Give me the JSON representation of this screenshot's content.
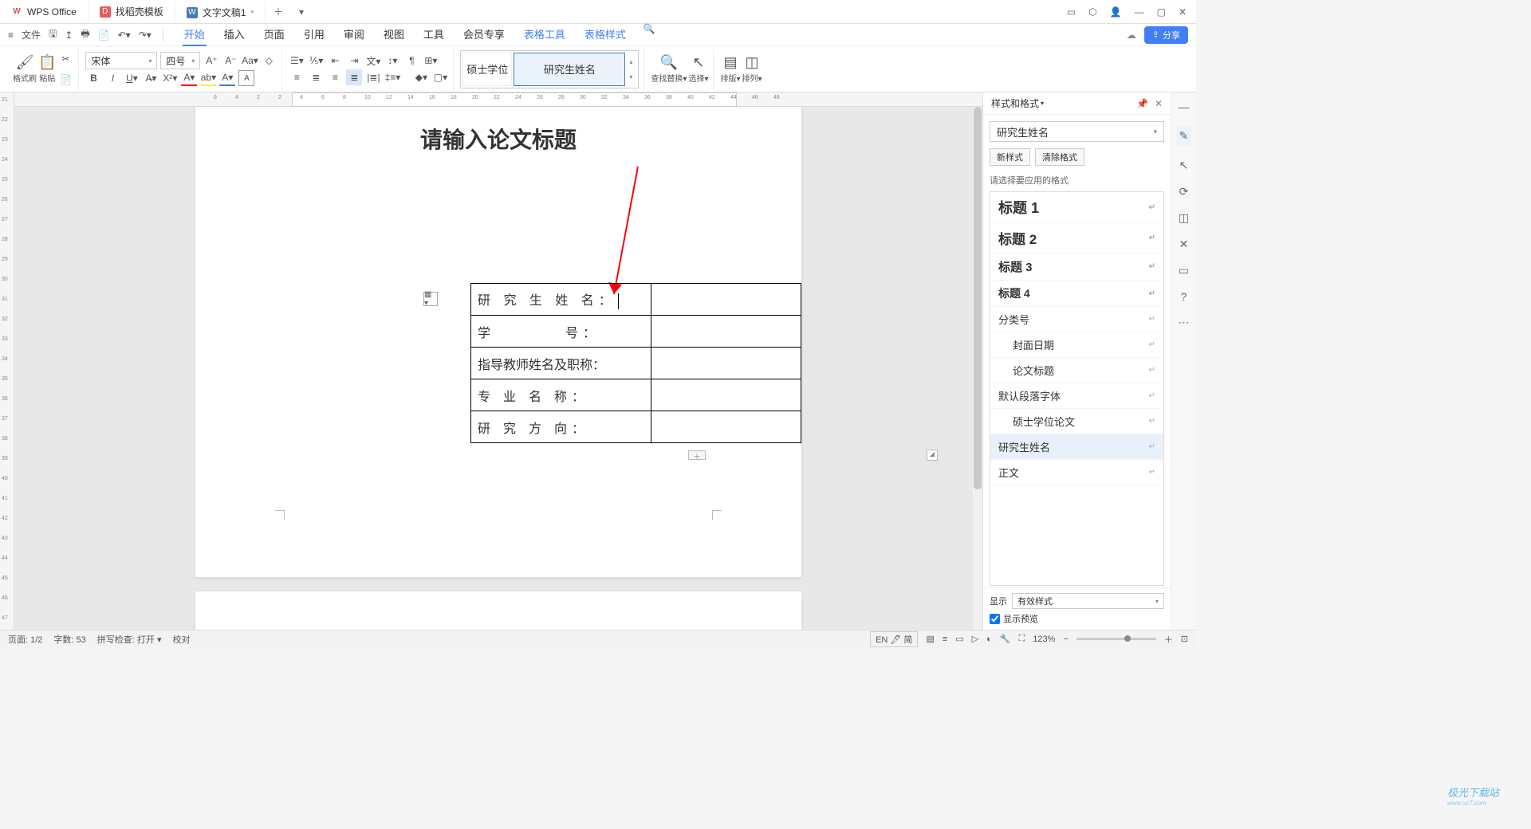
{
  "titlebar": {
    "tabs": [
      {
        "icon": "W",
        "label": "WPS Office"
      },
      {
        "icon": "D",
        "label": "找稻壳模板"
      },
      {
        "icon": "W",
        "label": "文字文稿1",
        "active": true,
        "dirty": "•"
      }
    ]
  },
  "menubar": {
    "file": "文件",
    "items": [
      "开始",
      "插入",
      "页面",
      "引用",
      "审阅",
      "视图",
      "工具",
      "会员专享",
      "表格工具",
      "表格样式"
    ],
    "active_index": 0,
    "blue_start": 8,
    "share": "分享"
  },
  "ribbon": {
    "format_painter": "格式刷",
    "paste": "粘贴",
    "font_name": "宋体",
    "font_size": "四号",
    "style_a": "硕士学位",
    "style_b": "研究生姓名",
    "find_replace": "查找替换",
    "select": "选择",
    "layout": "排版",
    "arrange": "排列"
  },
  "ruler_h": [
    "6",
    "4",
    "2",
    "2",
    "4",
    "6",
    "8",
    "10",
    "12",
    "14",
    "16",
    "18",
    "20",
    "22",
    "24",
    "26",
    "28",
    "30",
    "32",
    "34",
    "36",
    "38",
    "40",
    "42",
    "44",
    "46",
    "48"
  ],
  "ruler_v": [
    "21",
    "22",
    "23",
    "24",
    "25",
    "26",
    "27",
    "28",
    "29",
    "30",
    "31",
    "32",
    "33",
    "34",
    "35",
    "36",
    "37",
    "38",
    "39",
    "40",
    "41",
    "42",
    "43",
    "44",
    "45",
    "46",
    "47"
  ],
  "document": {
    "title": "请输入论文标题",
    "rows": [
      "研 究 生 姓 名：",
      "学　　　　号：",
      "指导教师姓名及职称：",
      "专 业 名 称：",
      "研 究 方 向："
    ]
  },
  "styles_panel": {
    "title": "样式和格式",
    "current": "研究生姓名",
    "btn_new": "新样式",
    "btn_clear": "清除格式",
    "hint": "请选择要应用的格式",
    "items": [
      {
        "label": "标题 1",
        "cls": "h1"
      },
      {
        "label": "标题 2",
        "cls": "h2"
      },
      {
        "label": "标题 3",
        "cls": "h3"
      },
      {
        "label": "标题 4",
        "cls": "h4"
      },
      {
        "label": "分类号",
        "cls": ""
      },
      {
        "label": "封面日期",
        "cls": "indent"
      },
      {
        "label": "论文标题",
        "cls": "indent"
      },
      {
        "label": "默认段落字体",
        "cls": ""
      },
      {
        "label": "硕士学位论文",
        "cls": "indent"
      },
      {
        "label": "研究生姓名",
        "cls": "sel"
      },
      {
        "label": "正文",
        "cls": ""
      }
    ],
    "show_label": "显示",
    "show_value": "有效样式",
    "preview": "显示预览"
  },
  "statusbar": {
    "page": "页面: 1/2",
    "words": "字数: 53",
    "spell": "拼写检查: 打开",
    "proof": "校对",
    "lang": "EN 🖊 简",
    "zoom": "123%"
  },
  "watermark": {
    "a": "极光下载站",
    "b": "www.xz7.com"
  }
}
